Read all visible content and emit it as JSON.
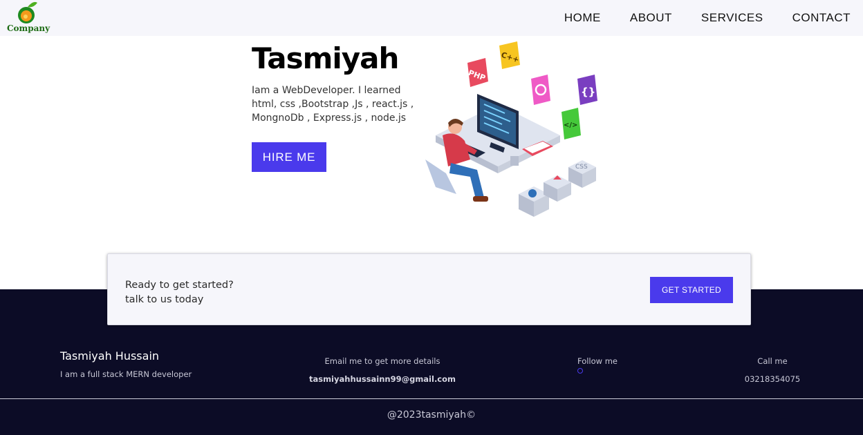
{
  "header": {
    "logo_text": "Company",
    "nav": [
      "HOME",
      "ABOUT",
      "SERVICES",
      "CONTACT"
    ]
  },
  "hero": {
    "title": "Tasmiyah",
    "description": "Iam a WebDeveloper. I learned html, css ,Bootstrap ,Js , react.js , MongnoDb , Express.js , node.js",
    "hire_button": "HIRE ME",
    "illustration_badges": [
      "PHP",
      "C++",
      "{}",
      "</>",
      "CSS"
    ]
  },
  "cta": {
    "line1": "Ready to get started?",
    "line2": "talk to us today",
    "button": "GET STARTED"
  },
  "footer": {
    "name": "Tasmiyah Hussain",
    "tagline": "I am a full stack MERN developer",
    "email_label": "Email me to get more details",
    "email_value": "tasmiyahhussainn99@gmail.com",
    "follow_label": "Follow me",
    "call_label": "Call me",
    "call_value": "03218354075",
    "copyright": "@2023tasmiyah©"
  },
  "colors": {
    "accent": "#4a3aec",
    "footer_bg": "#0c0c26",
    "header_bg": "#f6f6fb"
  }
}
